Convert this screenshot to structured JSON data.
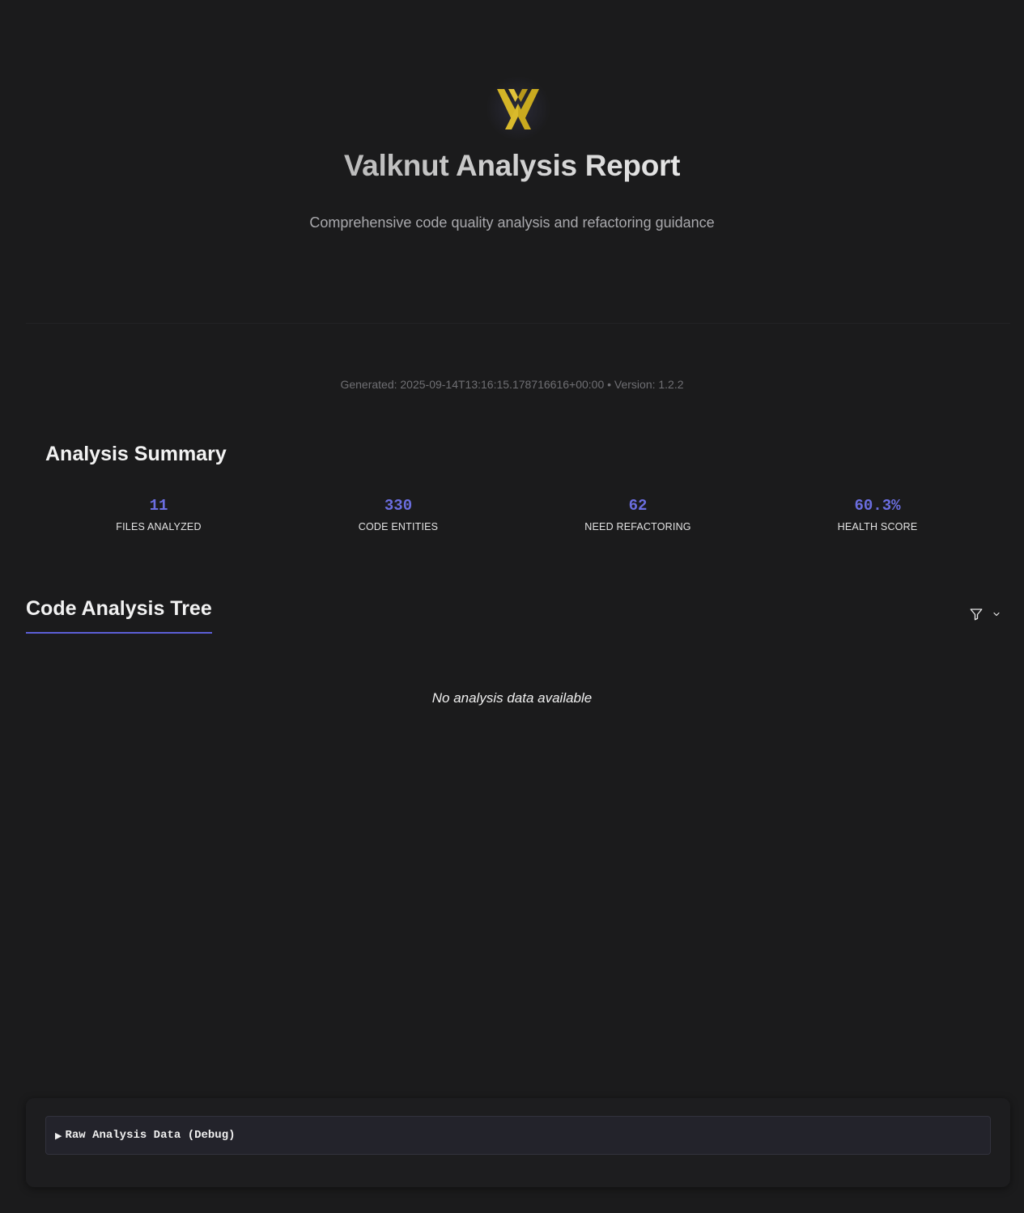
{
  "header": {
    "logo_icon": "valknut-logo-icon",
    "logo_color": "#d4b527",
    "title": "Valknut Analysis Report",
    "subtitle": "Comprehensive code quality analysis and refactoring guidance",
    "meta": "Generated: 2025-09-14T13:16:15.178716616+00:00 • Version: 1.2.2"
  },
  "summary": {
    "title": "Analysis Summary",
    "accent_color": "#6b6ee0",
    "stats": [
      {
        "value": "11",
        "label": "FILES ANALYZED"
      },
      {
        "value": "330",
        "label": "CODE ENTITIES"
      },
      {
        "value": "62",
        "label": "NEED REFACTORING"
      },
      {
        "value": "60.3%",
        "label": "HEALTH SCORE"
      }
    ]
  },
  "tree": {
    "title": "Code Analysis Tree",
    "filter_icon": "filter-icon",
    "expand_icon": "chevron-down-icon",
    "empty_message": "No analysis data available"
  },
  "debug": {
    "arrow_icon": "triangle-right-icon",
    "arrow_glyph": "▶",
    "label": "Raw Analysis Data (Debug)"
  }
}
